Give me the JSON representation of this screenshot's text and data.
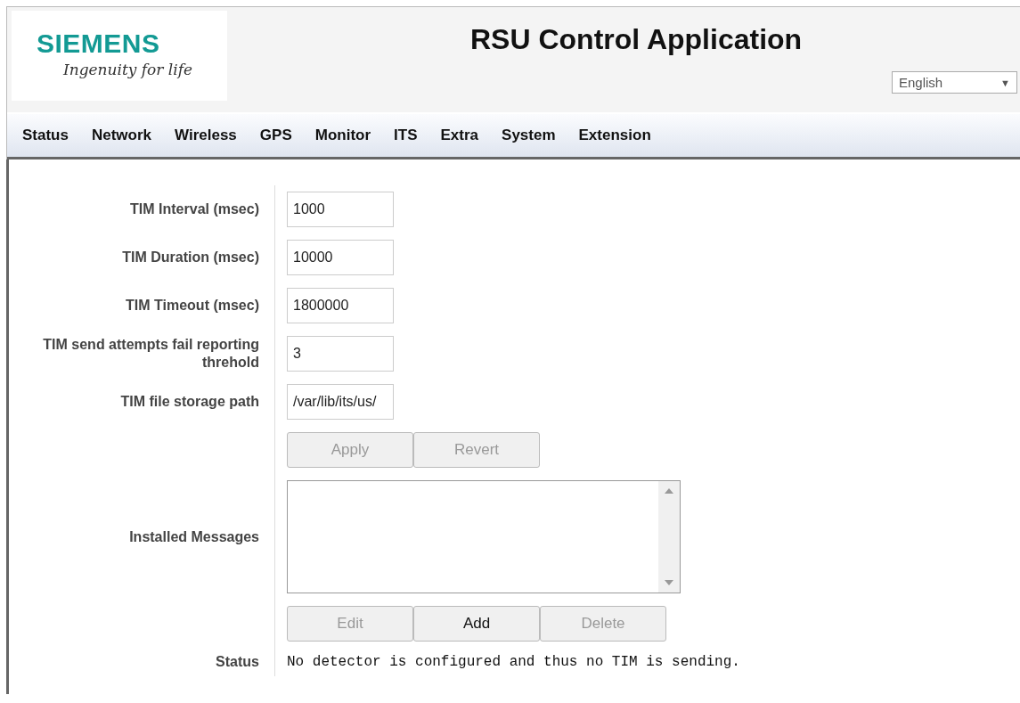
{
  "header": {
    "logo": {
      "brand": "SIEMENS",
      "tagline": "Ingenuity for life"
    },
    "title": "RSU Control Application",
    "language": {
      "value": "English",
      "arrow": "▼"
    }
  },
  "nav": [
    {
      "label": "Status"
    },
    {
      "label": "Network"
    },
    {
      "label": "Wireless"
    },
    {
      "label": "GPS"
    },
    {
      "label": "Monitor"
    },
    {
      "label": "ITS"
    },
    {
      "label": "Extra"
    },
    {
      "label": "System"
    },
    {
      "label": "Extension"
    }
  ],
  "form": [
    {
      "kind": "input",
      "label": "TIM Interval (msec)",
      "value": "1000"
    },
    {
      "kind": "input",
      "label": "TIM Duration (msec)",
      "value": "10000"
    },
    {
      "kind": "input",
      "label": "TIM Timeout (msec)",
      "value": "1800000"
    },
    {
      "kind": "input",
      "label": "TIM send attempts fail reporting threhold",
      "value": "3"
    },
    {
      "kind": "input",
      "label": "TIM file storage path",
      "value": "/var/lib/its/us/"
    },
    {
      "kind": "buttons",
      "buttons": [
        {
          "label": "Apply",
          "disabled": true
        },
        {
          "label": "Revert",
          "disabled": true
        }
      ]
    },
    {
      "kind": "listbox",
      "label": "Installed Messages"
    },
    {
      "kind": "buttons",
      "buttons": [
        {
          "label": "Edit",
          "disabled": true
        },
        {
          "label": "Add",
          "disabled": false
        },
        {
          "label": "Delete",
          "disabled": true
        }
      ]
    },
    {
      "kind": "text",
      "label": "Status",
      "text": "No detector is configured and thus no TIM is sending."
    }
  ]
}
